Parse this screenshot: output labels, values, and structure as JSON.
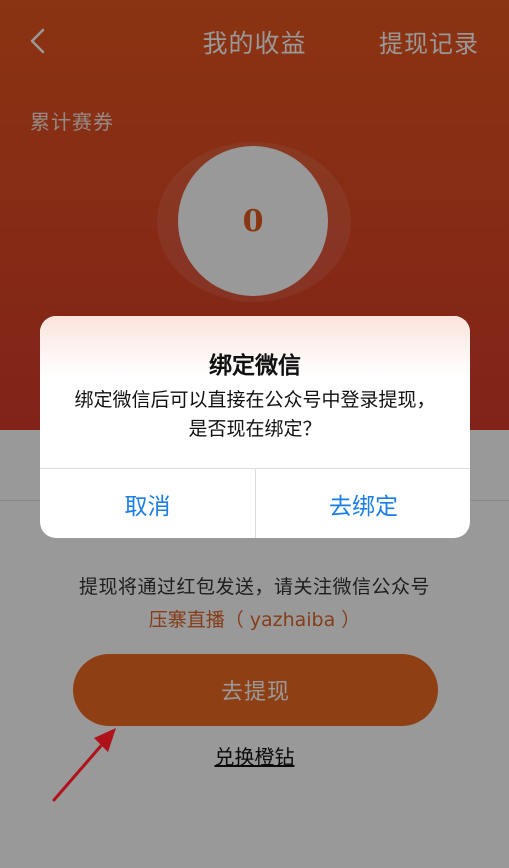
{
  "nav": {
    "title": "我的收益",
    "right_action": "提现记录",
    "back_icon": "chevron-left-icon"
  },
  "summary": {
    "label": "累计赛券",
    "balance": "0"
  },
  "withdraw_notice": {
    "line1": "提现将通过红包发送，请关注微信公众号",
    "account": "压寨直播（ yazhaiba ）"
  },
  "actions": {
    "withdraw_label": "去提现",
    "exchange_label": "兑换橙钻"
  },
  "dialog": {
    "title": "绑定微信",
    "message": "绑定微信后可以直接在公众号中登录提现，是否现在绑定？",
    "cancel_label": "取消",
    "confirm_label": "去绑定"
  },
  "colors": {
    "brand_orange": "#e8571e",
    "button_orange": "#ee6a22",
    "dialog_button_blue": "#1b7ee6",
    "annotation_arrow": "#b0121b"
  }
}
